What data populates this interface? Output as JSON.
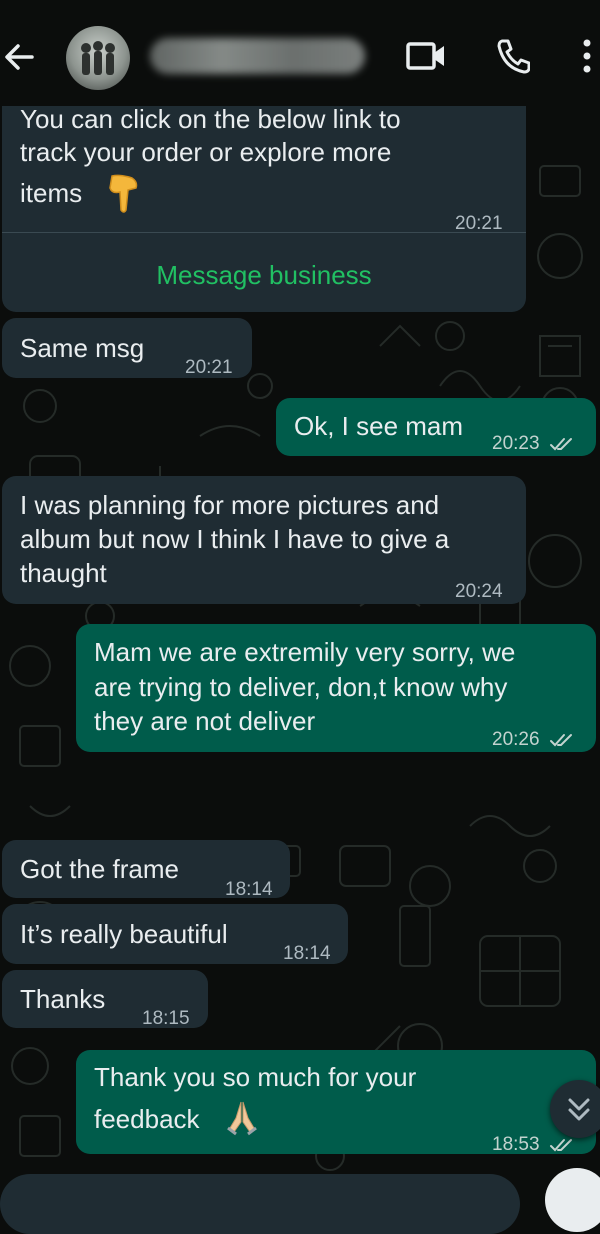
{
  "header": {
    "back_icon": "arrow-left-icon",
    "video_icon": "video-call-icon",
    "call_icon": "phone-icon",
    "menu_icon": "more-vertical-icon"
  },
  "messages": [
    {
      "dir": "in",
      "lines": [
        "You can click on the below link to",
        "track your order or explore more",
        "items"
      ],
      "emoji": "backhand-index-pointing-down",
      "time": "20:21",
      "action": "Message business"
    },
    {
      "dir": "in",
      "text": "Same msg",
      "time": "20:21"
    },
    {
      "dir": "out",
      "text": "Ok, I see mam",
      "time": "20:23",
      "status": "read"
    },
    {
      "dir": "in",
      "lines": [
        "I was planning for more pictures and",
        "album but now I think I have to give a",
        "thaught"
      ],
      "time": "20:24"
    },
    {
      "dir": "out",
      "lines": [
        "Mam we are extremily very sorry, we",
        "are trying to deliver, don,t know why",
        "they are not deliver"
      ],
      "time": "20:26",
      "status": "read"
    },
    {
      "dir": "in",
      "text": "Got the frame",
      "time": "18:14"
    },
    {
      "dir": "in",
      "text": "It’s really beautiful",
      "time": "18:14"
    },
    {
      "dir": "in",
      "text": "Thanks",
      "time": "18:15"
    },
    {
      "dir": "out",
      "lines": [
        "Thank you so much for your",
        "feedback"
      ],
      "emoji": "folded-hands",
      "time": "18:53",
      "status": "read"
    }
  ],
  "colors": {
    "background": "#0b0d0c",
    "incoming_bubble": "#1f2c33",
    "outgoing_bubble": "#005c4b",
    "accent_green": "#21c063"
  },
  "controls": {
    "scroll_down_icon": "double-chevron-down-icon",
    "mic_icon": "mic-icon"
  }
}
